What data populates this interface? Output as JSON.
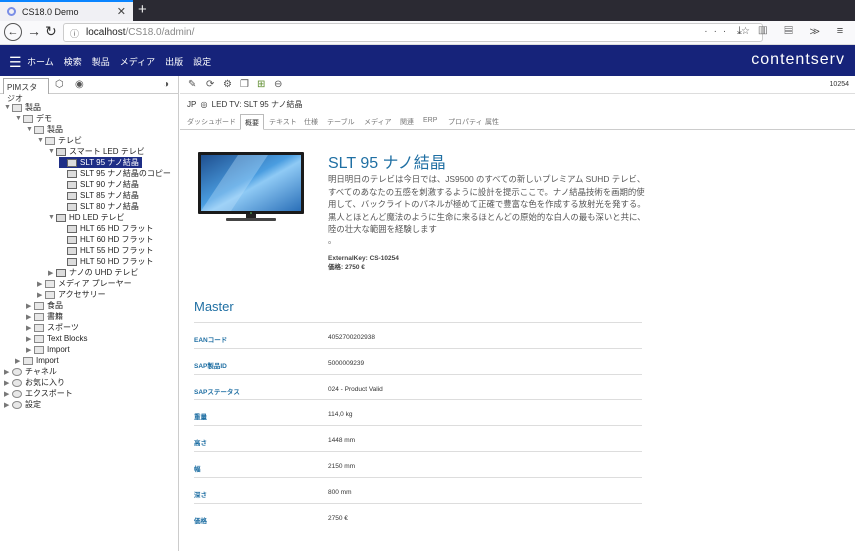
{
  "browser": {
    "tab_title": "CS18.0 Demo",
    "url_host": "localhost",
    "url_path": "/CS18.0/admin/"
  },
  "appbar": {
    "menu": [
      "ホーム",
      "検索",
      "製品",
      "メディア",
      "出版",
      "設定"
    ],
    "brand": "contentserv"
  },
  "sidebar": {
    "tab_label": "PIMスタジオ",
    "tree": [
      {
        "label": "製品",
        "level": 0,
        "open": true
      },
      {
        "label": "デモ",
        "level": 1,
        "open": true
      },
      {
        "label": "製品",
        "level": 2,
        "open": true
      },
      {
        "label": "テレビ",
        "level": 3,
        "open": true
      },
      {
        "label": "スマート LED テレビ",
        "level": 4,
        "open": true
      },
      {
        "label": "SLT 95 ナノ結晶",
        "level": 5,
        "selected": true
      },
      {
        "label": "SLT 95 ナノ結晶のコピー",
        "level": 5
      },
      {
        "label": "SLT 90 ナノ結晶",
        "level": 5
      },
      {
        "label": "SLT 85 ナノ結晶",
        "level": 5
      },
      {
        "label": "SLT 80 ナノ結晶",
        "level": 5
      },
      {
        "label": "HD LED テレビ",
        "level": 4,
        "open": true
      },
      {
        "label": "HLT 65 HD フラット",
        "level": 5
      },
      {
        "label": "HLT 60 HD フラット",
        "level": 5
      },
      {
        "label": "HLT 55 HD フラット",
        "level": 5
      },
      {
        "label": "HLT 50 HD フラット",
        "level": 5
      },
      {
        "label": "ナノの UHD テレビ",
        "level": 4
      },
      {
        "label": "メディア プレーヤー",
        "level": 3
      },
      {
        "label": "アクセサリー",
        "level": 3
      },
      {
        "label": "食品",
        "level": 2
      },
      {
        "label": "書籍",
        "level": 2
      },
      {
        "label": "スポーツ",
        "level": 2
      },
      {
        "label": "Text Blocks",
        "level": 2
      },
      {
        "label": "Import",
        "level": 2
      },
      {
        "label": "Import",
        "level": 1
      },
      {
        "label": "チャネル",
        "level": 0
      },
      {
        "label": "お気に入り",
        "level": 0
      },
      {
        "label": "エクスポート",
        "level": 0
      },
      {
        "label": "設定",
        "level": 0
      }
    ]
  },
  "main": {
    "record_id": "10254",
    "breadcrumb_lang": "JP",
    "breadcrumb": "LED TV: SLT 95 ナノ結晶",
    "tabs": [
      "ダッシュボード",
      "概要",
      "テキスト",
      "仕様",
      "テーブル",
      "メディア",
      "関連",
      "ERP",
      "プロパティ",
      "属性"
    ],
    "active_tab": 1,
    "product": {
      "title": "SLT 95 ナノ結晶",
      "description": "明日明日のテレビは今日では、JS9500 のすべての新しいプレミアム SUHD テレビ、すべてのあなたの五感を刺激するように設計を提示ここで。ナノ結晶技術を画期的使用して、バックライトのパネルが極めて正確で豊富な色を作成する放射光を発する。黒人とほとんど魔法のように生命に来るほとんどの原始的な白人の最も深いと共に、陸の壮大な範囲を経験します",
      "dot": "。",
      "external_key_label": "ExternalKey:",
      "external_key": "CS-10254",
      "price_label": "価格:",
      "price": "2750 €"
    },
    "master_title": "Master",
    "attributes": [
      {
        "label": "EANコード",
        "value": "4052700202938"
      },
      {
        "label": "SAP製品ID",
        "value": "5000009239"
      },
      {
        "label": "SAPステータス",
        "value": "024 - Product Valid"
      },
      {
        "label": "重量",
        "value": "114,0 kg"
      },
      {
        "label": "高さ",
        "value": "1448 mm"
      },
      {
        "label": "幅",
        "value": "2150 mm"
      },
      {
        "label": "深さ",
        "value": "800 mm"
      },
      {
        "label": "価格",
        "value": "2750 €"
      }
    ]
  }
}
